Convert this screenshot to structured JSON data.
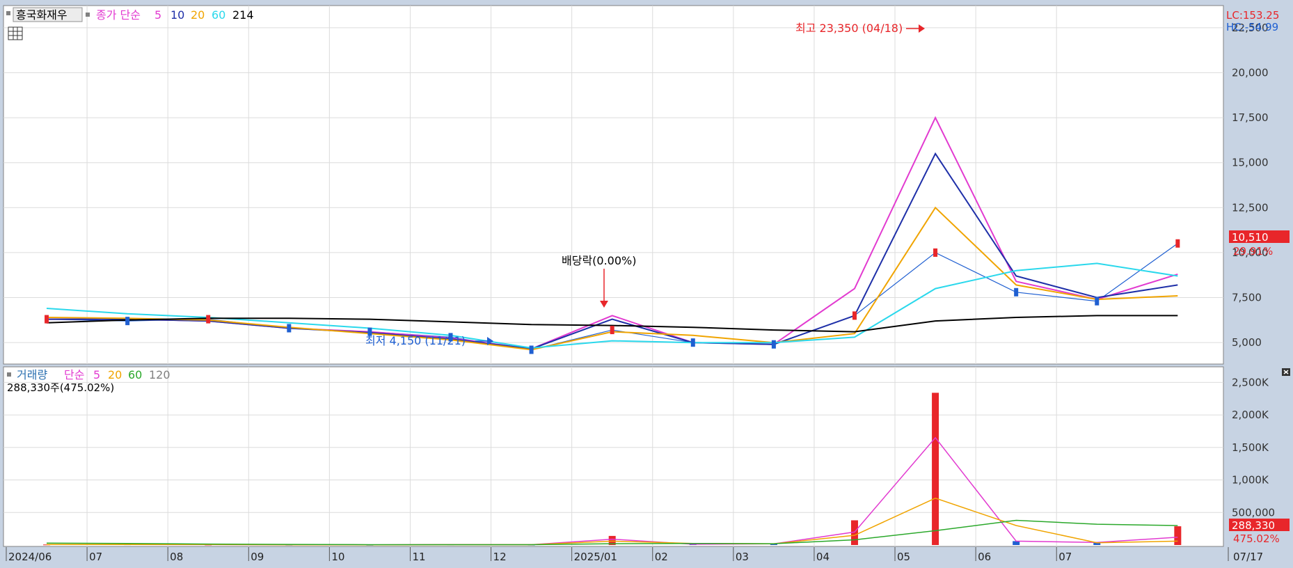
{
  "colors": {
    "up": "#e8262a",
    "down": "#1f5fd1",
    "ma5": "#e23ad0",
    "ma10": "#1e2fa8",
    "ma20": "#f0a400",
    "ma60": "#2ad8ec",
    "ma214": "#000000",
    "vol_ma5": "#e23ad0",
    "vol_ma20": "#f0a400",
    "vol_ma60": "#2aa82a",
    "vol_ma120": "#808080"
  },
  "legend": {
    "stock_name": "흥국화재우",
    "price_label": "종가 단순",
    "ma_periods": [
      "5",
      "10",
      "20",
      "60",
      "214"
    ],
    "volume_label": "거래량",
    "volume_ma_label": "단순",
    "volume_ma_periods": [
      "5",
      "20",
      "60",
      "120"
    ],
    "volume_info": "288,330주(475.02%)"
  },
  "header_right": {
    "lc": "LC:153.25",
    "hc": "HC:-54.99"
  },
  "annotations": {
    "high": "최고 23,350 (04/18)",
    "low": "최저 4,150 (11/21)",
    "dividend": "배당락(0.00%)"
  },
  "price_badge": {
    "value": "10,510",
    "change": "29.91%"
  },
  "volume_badge": {
    "value": "288,330",
    "change": "475.02%"
  },
  "chart_data": [
    {
      "type": "line",
      "title": "흥국화재우",
      "x": [
        "2024/06",
        "07",
        "08",
        "09",
        "10",
        "11",
        "12",
        "2025/01",
        "02",
        "03",
        "04",
        "05",
        "06",
        "07",
        "07/17"
      ],
      "ylim": [
        4000,
        23500
      ],
      "y_ticks": [
        "5,000",
        "7,500",
        "10,000",
        "12,500",
        "15,000",
        "17,500",
        "20,000",
        "22,500"
      ],
      "series": [
        {
          "name": "종가",
          "values": [
            6300,
            6200,
            6300,
            5800,
            5600,
            5300,
            4600,
            5700,
            5000,
            4900,
            6500,
            10000,
            7800,
            7300,
            10510
          ]
        },
        {
          "name": "5",
          "values": [
            6300,
            6300,
            6200,
            5800,
            5600,
            5250,
            4650,
            6500,
            5000,
            4900,
            8000,
            17500,
            8400,
            7400,
            8800
          ]
        },
        {
          "name": "10",
          "values": [
            6300,
            6300,
            6200,
            5800,
            5550,
            5200,
            4650,
            6300,
            5000,
            4900,
            6500,
            15500,
            8700,
            7500,
            8200
          ]
        },
        {
          "name": "20",
          "values": [
            6400,
            6350,
            6250,
            5850,
            5500,
            5150,
            4600,
            5600,
            5400,
            5000,
            5500,
            12500,
            8200,
            7400,
            7600
          ]
        },
        {
          "name": "60",
          "values": [
            6900,
            6600,
            6400,
            6100,
            5800,
            5400,
            4700,
            5100,
            5000,
            5000,
            5300,
            8000,
            9000,
            9400,
            8700
          ]
        },
        {
          "name": "214",
          "values": [
            6100,
            6250,
            6350,
            6350,
            6300,
            6150,
            6000,
            5950,
            5850,
            5700,
            5600,
            6200,
            6400,
            6500,
            6500
          ]
        }
      ]
    },
    {
      "type": "bar",
      "title": "거래량",
      "x": [
        "2024/06",
        "07",
        "08",
        "09",
        "10",
        "11",
        "12",
        "2025/01",
        "02",
        "03",
        "04",
        "05",
        "06",
        "07",
        "07/17"
      ],
      "ylim": [
        0,
        2600000
      ],
      "y_ticks": [
        "500,000",
        "1,000K",
        "1,500K",
        "2,000K",
        "2,500K"
      ],
      "series": [
        {
          "name": "거래량",
          "values": [
            8000,
            10000,
            6000,
            4000,
            3000,
            9000,
            5000,
            140000,
            15000,
            20000,
            380000,
            2340000,
            60000,
            40000,
            288330
          ]
        },
        {
          "name": "5",
          "values": [
            8000,
            9000,
            6000,
            4000,
            3000,
            6000,
            5000,
            90000,
            12000,
            18000,
            200000,
            1650000,
            60000,
            40000,
            120000
          ]
        },
        {
          "name": "20",
          "values": [
            9000,
            9000,
            7000,
            4000,
            3000,
            5000,
            5000,
            60000,
            25000,
            18000,
            150000,
            720000,
            300000,
            35000,
            60000
          ]
        },
        {
          "name": "60",
          "values": [
            30000,
            25000,
            15000,
            10000,
            5000,
            5000,
            5000,
            20000,
            25000,
            20000,
            80000,
            220000,
            380000,
            320000,
            300000
          ]
        }
      ]
    }
  ]
}
